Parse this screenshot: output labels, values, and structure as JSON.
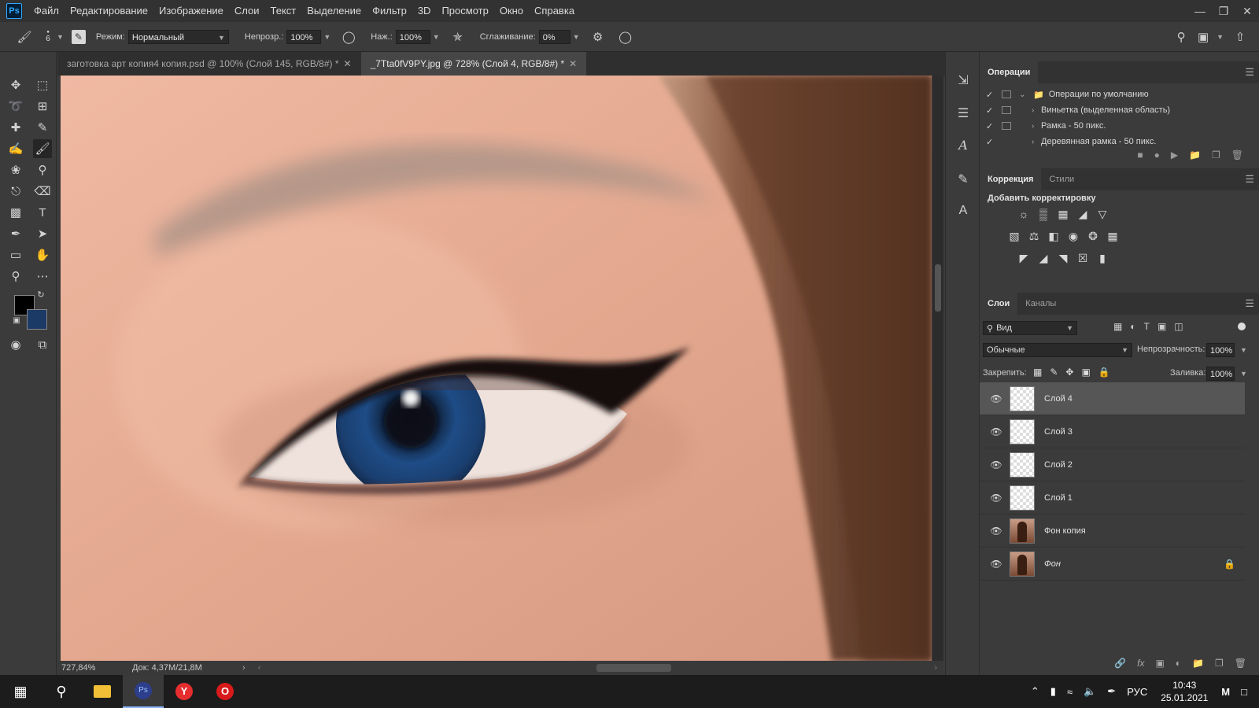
{
  "menubar": {
    "logo": "Ps",
    "items": [
      "Файл",
      "Редактирование",
      "Изображение",
      "Слои",
      "Текст",
      "Выделение",
      "Фильтр",
      "3D",
      "Просмотр",
      "Окно",
      "Справка"
    ]
  },
  "options": {
    "brush_size": "6",
    "mode_label": "Режим:",
    "mode_value": "Нормальный",
    "opacity_label": "Непрозр.:",
    "opacity_value": "100%",
    "pressure_label": "Наж.:",
    "pressure_value": "100%",
    "smoothing_label": "Сглаживание:",
    "smoothing_value": "0%"
  },
  "tabs": [
    {
      "label": "заготовка арт копия4 копия.psd @ 100% (Слой 145, RGB/8#) *"
    },
    {
      "label": "_7Tta0fV9PY.jpg @ 728% (Слой 4, RGB/8#) *"
    }
  ],
  "status": {
    "zoom": "727,84%",
    "doc": "Док: 4,37M/21,8M"
  },
  "actions_panel": {
    "tab": "Операции",
    "rows": [
      {
        "label": "Операции по умолчанию",
        "folder": true
      },
      {
        "label": "Виньетка (выделенная область)"
      },
      {
        "label": "Рамка - 50 пикс."
      },
      {
        "label": "Деревянная рамка - 50 пикс."
      }
    ]
  },
  "adjust_panel": {
    "tabs": [
      "Коррекция",
      "Стили"
    ],
    "add_label": "Добавить корректировку"
  },
  "layers_panel": {
    "tabs": [
      "Слои",
      "Каналы"
    ],
    "filter_label": "Вид",
    "blend_mode": "Обычные",
    "opacity_label": "Непрозрачность:",
    "opacity_value": "100%",
    "lock_label": "Закрепить:",
    "fill_label": "Заливка:",
    "fill_value": "100%",
    "layers": [
      {
        "name": "Слой 4",
        "selected": true,
        "photo": false
      },
      {
        "name": "Слой 3",
        "photo": false
      },
      {
        "name": "Слой 2",
        "photo": false
      },
      {
        "name": "Слой 1",
        "photo": false
      },
      {
        "name": "Фон копия",
        "photo": true
      },
      {
        "name": "Фон",
        "photo": true,
        "locked": true
      }
    ]
  },
  "taskbar": {
    "lang": "РУС",
    "time": "10:43",
    "date": "25.01.2021"
  },
  "colors": {
    "foreground": "#000000",
    "background": "#1c3a66",
    "accent": "#31a8ff"
  }
}
